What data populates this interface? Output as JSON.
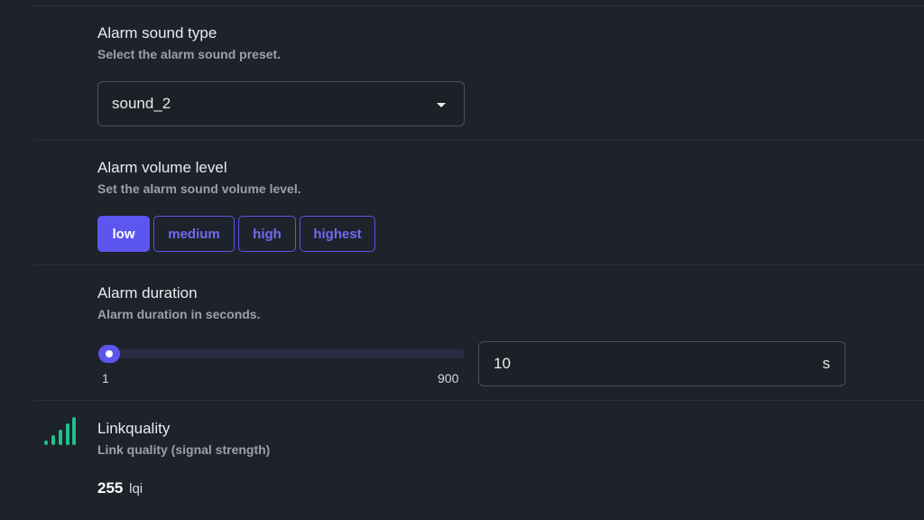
{
  "alarm_sound": {
    "title": "Alarm sound type",
    "description": "Select the alarm sound preset.",
    "selected": "sound_2"
  },
  "alarm_volume": {
    "title": "Alarm volume level",
    "description": "Set the alarm sound volume level.",
    "options": [
      {
        "label": "low",
        "active": true
      },
      {
        "label": "medium",
        "active": false
      },
      {
        "label": "high",
        "active": false
      },
      {
        "label": "highest",
        "active": false
      }
    ]
  },
  "alarm_duration": {
    "title": "Alarm duration",
    "description": "Alarm duration in seconds.",
    "min": "1",
    "max": "900",
    "value": "10",
    "unit": "s"
  },
  "linkquality": {
    "title": "Linkquality",
    "description": "Link quality (signal strength)",
    "value": "255",
    "unit": "lqi",
    "icon": "signal-icon"
  },
  "colors": {
    "accent": "#5b56ee",
    "signal": "#1fc08a",
    "background": "#1e222a"
  }
}
